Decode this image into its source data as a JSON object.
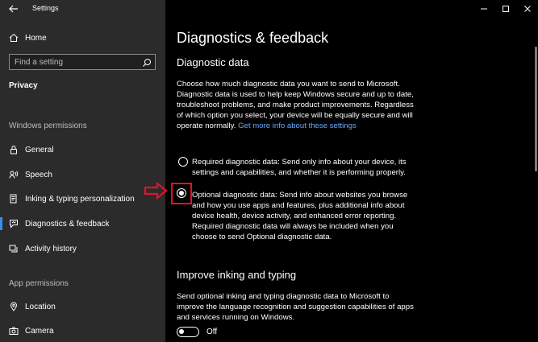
{
  "app": {
    "title": "Settings"
  },
  "sidebar": {
    "home_label": "Home",
    "search_placeholder": "Find a setting",
    "current_section": "Privacy",
    "windows_permissions_label": "Windows permissions",
    "windows_items": [
      {
        "label": "General",
        "icon": "lock-icon"
      },
      {
        "label": "Speech",
        "icon": "speech-icon"
      },
      {
        "label": "Inking & typing personalization",
        "icon": "inking-icon"
      },
      {
        "label": "Diagnostics & feedback",
        "icon": "diagnostics-icon",
        "selected": true
      },
      {
        "label": "Activity history",
        "icon": "activity-icon"
      }
    ],
    "app_permissions_label": "App permissions",
    "app_items": [
      {
        "label": "Location",
        "icon": "location-icon"
      },
      {
        "label": "Camera",
        "icon": "camera-icon"
      }
    ]
  },
  "main": {
    "page_title": "Diagnostics & feedback",
    "diagnostic": {
      "heading": "Diagnostic data",
      "description": "Choose how much diagnostic data you want to send to Microsoft. Diagnostic data is used to help keep Windows secure and up to date, troubleshoot problems, and make product improvements. Regardless of which option you select, your device will be equally secure and will operate normally.",
      "link_text": "Get more info about these settings",
      "options": [
        {
          "label": "Required diagnostic data: Send only info about your device, its settings and capabilities, and whether it is performing properly.",
          "checked": false
        },
        {
          "label": "Optional diagnostic data: Send info about websites you browse and how you use apps and features, plus additional info about device health, device activity, and enhanced error reporting. Required diagnostic data will always be included when you choose to send Optional diagnostic data.",
          "checked": true
        }
      ]
    },
    "inking": {
      "heading": "Improve inking and typing",
      "description": "Send optional inking and typing diagnostic data to Microsoft to improve the language recognition and suggestion capabilities of apps and services running on Windows.",
      "toggle_state": "Off"
    }
  },
  "colors": {
    "sidebar_bg": "#2b2b2b",
    "content_bg": "#000000",
    "accent": "#3b8eea",
    "link": "#69a9ff",
    "highlight": "#e2122a"
  }
}
